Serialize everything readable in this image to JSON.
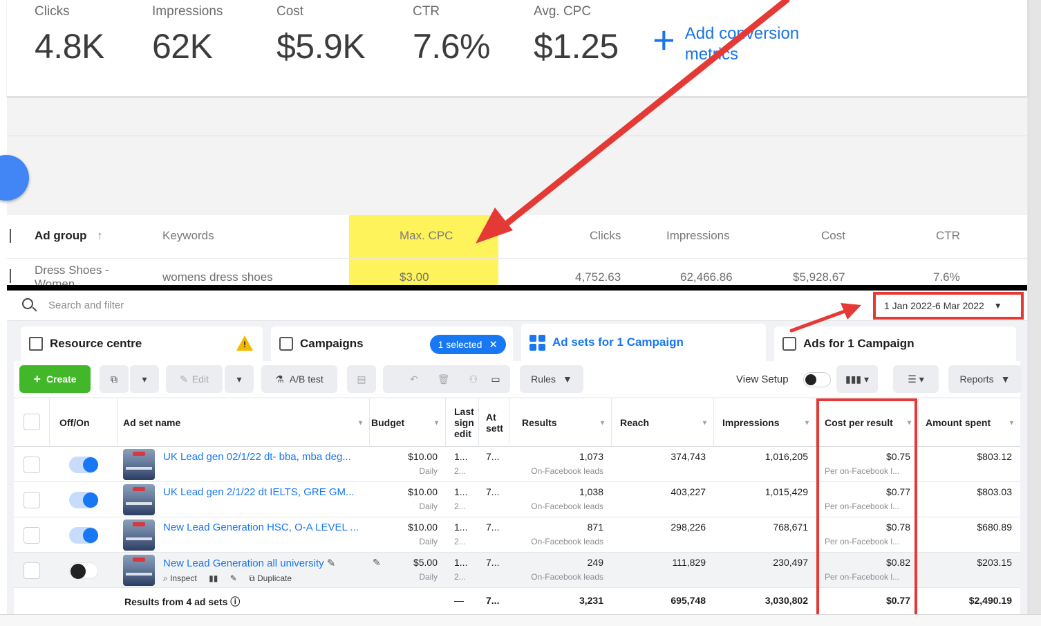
{
  "google": {
    "metrics": [
      {
        "label": "Clicks",
        "value": "4.8K"
      },
      {
        "label": "Impressions",
        "value": "62K"
      },
      {
        "label": "Cost",
        "value": "$5.9K"
      },
      {
        "label": "CTR",
        "value": "7.6%"
      },
      {
        "label": "Avg. CPC",
        "value": "$1.25"
      }
    ],
    "add_conversion": "Add conversion metrics",
    "table": {
      "headers": {
        "ad_group": "Ad group",
        "keywords": "Keywords",
        "max_cpc": "Max. CPC",
        "clicks": "Clicks",
        "impressions": "Impressions",
        "cost": "Cost",
        "ctr": "CTR"
      },
      "row": {
        "ad_group": "Dress Shoes - Women",
        "keywords": "womens dress shoes",
        "max_cpc": "$3.00",
        "clicks": "4,752.63",
        "impressions": "62,466.86",
        "cost": "$5,928.67",
        "ctr": "7.6%"
      }
    }
  },
  "facebook": {
    "search_placeholder": "Search and filter",
    "date_range": "1 Jan 2022-6 Mar 2022",
    "tabs": {
      "resource": "Resource centre",
      "campaigns": "Campaigns",
      "selected": "1 selected",
      "ad_sets": "Ad sets for 1 Campaign",
      "ads": "Ads for 1 Campaign"
    },
    "toolbar": {
      "create": "Create",
      "edit": "Edit",
      "ab_test": "A/B test",
      "rules": "Rules",
      "view_setup": "View Setup",
      "reports": "Reports"
    },
    "columns": {
      "off_on": "Off/On",
      "ad_set_name": "Ad set name",
      "budget": "Budget",
      "last_edit": "Last sign edit",
      "attribution": "At sett",
      "results": "Results",
      "reach": "Reach",
      "impressions": "Impressions",
      "cost_per_result": "Cost per result",
      "amount_spent": "Amount spent"
    },
    "rows": [
      {
        "name": "UK Lead gen 02/1/22 dt- bba, mba deg...",
        "budget": "$10.00",
        "budget_sub": "Daily",
        "last": "1...",
        "last_sub": "2...",
        "attr": "7...",
        "results": "1,073",
        "results_sub": "On-Facebook leads",
        "reach": "374,743",
        "impressions": "1,016,205",
        "cpr": "$0.75",
        "cpr_sub": "Per on-Facebook l...",
        "spent": "$803.12"
      },
      {
        "name": "UK Lead gen 2/1/22 dt IELTS, GRE GM...",
        "budget": "$10.00",
        "budget_sub": "Daily",
        "last": "1...",
        "last_sub": "2...",
        "attr": "7...",
        "results": "1,038",
        "results_sub": "On-Facebook leads",
        "reach": "403,227",
        "impressions": "1,015,429",
        "cpr": "$0.77",
        "cpr_sub": "Per on-Facebook l...",
        "spent": "$803.03"
      },
      {
        "name": "New Lead Generation HSC, O-A LEVEL ...",
        "budget": "$10.00",
        "budget_sub": "Daily",
        "last": "1...",
        "last_sub": "2...",
        "attr": "7...",
        "results": "871",
        "results_sub": "On-Facebook leads",
        "reach": "298,226",
        "impressions": "768,671",
        "cpr": "$0.78",
        "cpr_sub": "Per on-Facebook l...",
        "spent": "$680.89"
      },
      {
        "name": "New Lead Generation all university",
        "budget": "$5.00",
        "budget_sub": "Daily",
        "last": "1...",
        "last_sub": "2...",
        "attr": "7...",
        "results": "249",
        "results_sub": "On-Facebook leads",
        "reach": "111,829",
        "impressions": "230,497",
        "cpr": "$0.82",
        "cpr_sub": "Per on-Facebook l...",
        "spent": "$203.15",
        "inspect": "Inspect",
        "duplicate": "Duplicate"
      }
    ],
    "totals": {
      "label": "Results from 4 ad sets",
      "last": "—",
      "attr": "7...",
      "results": "3,231",
      "reach": "695,748",
      "impressions": "3,030,802",
      "cpr": "$0.77",
      "spent": "$2,490.19"
    }
  }
}
